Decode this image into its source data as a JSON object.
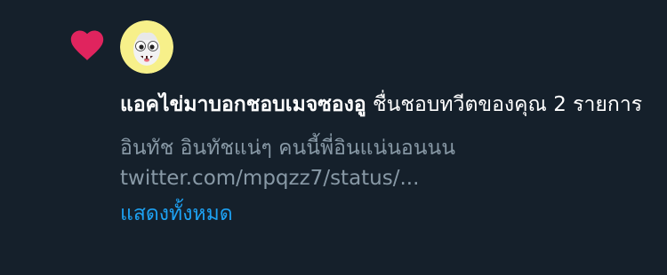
{
  "notification": {
    "type": "like",
    "heart_color": "#e0245e",
    "avatar_icon": "egg-face-avatar",
    "actor": "แอคไข่มาบอกชอบเมจซองอู",
    "action_text": " ชื่นชอบทวีตของคุณ 2 รายการ",
    "tweet_preview": "อินทัช อินทัชแน่ๆ คนนี้พี่อินแน่นอนนน twitter.com/mpqzz7/status/...",
    "show_all_label": "แสดงทั้งหมด"
  },
  "colors": {
    "background": "#15202b",
    "text_primary": "#ffffff",
    "text_secondary": "#8899a6",
    "link": "#1da1f2",
    "like": "#e0245e"
  }
}
